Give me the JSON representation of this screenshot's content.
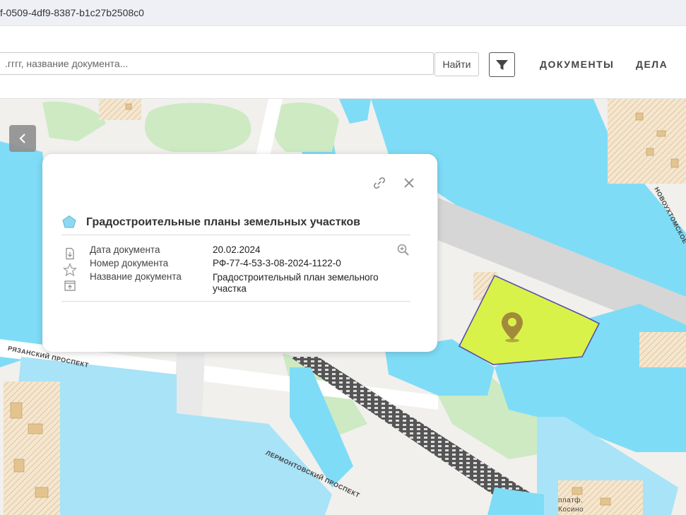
{
  "browser": {
    "url_fragment": "f-0509-4df9-8387-b1c27b2508c0"
  },
  "header": {
    "search_placeholder": ".гггг, название документа...",
    "find_label": "Найти",
    "nav_documents": "ДОКУМЕНТЫ",
    "nav_cases": "ДЕЛА"
  },
  "popup": {
    "layer_title": "Градостроительные планы земельных участков",
    "fields": {
      "date_label": "Дата документа",
      "date_value": "20.02.2024",
      "number_label": "Номер документа",
      "number_value": "РФ-77-4-53-3-08-2024-1122-0",
      "name_label": "Название документа",
      "name_value_line1": "Градостроительный план земельного",
      "name_value_line2": "участка"
    }
  },
  "map": {
    "streets": {
      "ryazansky": "РЯЗАНСКИЙ ПРОСПЕКТ",
      "lermontovsky": "ЛЕРМОНТОВСКИЙ ПРОСПЕКТ",
      "novokhomskoe": "НОВОУХТОМСКОЕ",
      "platform_line1": "платф.",
      "platform_line2": "Косино"
    },
    "colors": {
      "water": "#7fdcf6",
      "zone_fill": "#a8e3f7",
      "parcel_fill": "#d9f24a",
      "parcel_outline": "#5a4ea8",
      "marker": "#a38a3a",
      "greenery": "#cdeac3"
    }
  }
}
